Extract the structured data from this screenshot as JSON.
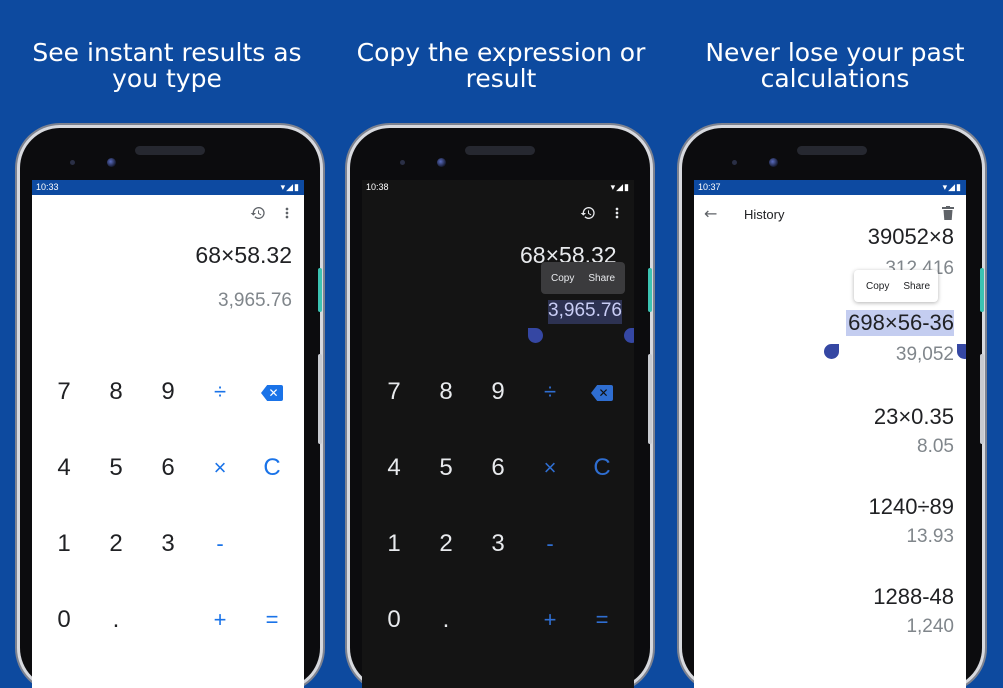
{
  "captions": [
    {
      "line1": "See instant results as",
      "line2": "you type"
    },
    {
      "line1": "Copy the expression or",
      "line2": "result"
    },
    {
      "line1": "Never lose your past",
      "line2": "calculations"
    }
  ],
  "colors": {
    "background": "#0d4a9f",
    "accent": "#1a73e8",
    "status_bar": "#0d4aa1",
    "selection": "#c4cdf0",
    "handle": "#3547a3"
  },
  "icons": {
    "history": "history-icon",
    "more": "more-vert-icon",
    "backspace": "backspace-icon",
    "back": "arrow-back-icon",
    "delete": "trash-icon",
    "wifi": "wifi-icon",
    "signal": "signal-icon",
    "battery": "battery-icon"
  },
  "phone1": {
    "time": "10:33",
    "expression": "68×58.32",
    "result": "3,965.76",
    "keys": {
      "k7": "7",
      "k8": "8",
      "k9": "9",
      "div": "÷",
      "k4": "4",
      "k5": "5",
      "k6": "6",
      "mul": "×",
      "clear": "C",
      "k1": "1",
      "k2": "2",
      "k3": "3",
      "sub": "-",
      "k0": "0",
      "dot": ".",
      "add": "+",
      "eq": "="
    }
  },
  "phone2": {
    "time": "10:38",
    "expression_visible": "68",
    "expression_hidden": "×58.32",
    "result": "3,965.76",
    "popup": {
      "copy": "Copy",
      "share": "Share"
    },
    "keys": {
      "k7": "7",
      "k8": "8",
      "k9": "9",
      "div": "÷",
      "k4": "4",
      "k5": "5",
      "k6": "6",
      "mul": "×",
      "clear": "C",
      "k1": "1",
      "k2": "2",
      "k3": "3",
      "sub": "-",
      "k0": "0",
      "dot": ".",
      "add": "+",
      "eq": "="
    }
  },
  "phone3": {
    "time": "10:37",
    "title": "History",
    "popup": {
      "copy": "Copy",
      "share": "Share"
    },
    "entries": [
      {
        "expression": "39052×8",
        "result": "312,416"
      },
      {
        "expression": "698×56-36",
        "result": "39,052"
      },
      {
        "expression": "23×0.35",
        "result": "8.05"
      },
      {
        "expression": "1240÷89",
        "result": "13.93"
      },
      {
        "expression": "1288-48",
        "result": "1,240"
      }
    ]
  }
}
